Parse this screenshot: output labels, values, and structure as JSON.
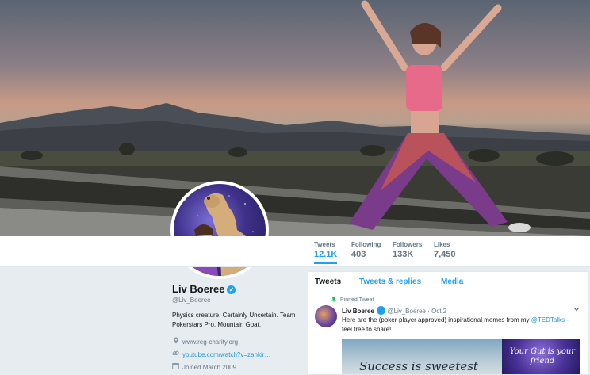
{
  "profile": {
    "name": "Liv Boeree",
    "verified_glyph": "✓",
    "handle": "@Liv_Boeree",
    "bio": "Physics creature. Certainly Uncertain. Team Pokerstars Pro. Mountain Goat.",
    "website": "www.reg-charity.org",
    "link": "youtube.com/watch?v=zankir…",
    "joined": "Joined March 2009"
  },
  "stats": [
    {
      "label": "Tweets",
      "value": "12.1K"
    },
    {
      "label": "Following",
      "value": "403"
    },
    {
      "label": "Followers",
      "value": "133K"
    },
    {
      "label": "Likes",
      "value": "7,450"
    }
  ],
  "timeline": {
    "tabs": [
      "Tweets",
      "Tweets & replies",
      "Media"
    ],
    "pinned_label": "Pinned Tweet",
    "tweet": {
      "name": "Liv Boeree",
      "handle": "@Liv_Boeree",
      "sep": "·",
      "date": "Oct 2",
      "text_before": "Here are the (poker-player approved) inspirational memes from my ",
      "mention": "@TEDTalks",
      "text_after": " - feel free to share!",
      "image_left_caption": "Success is sweetest",
      "image_right_caption": "Your Gut is your friend"
    }
  },
  "colors": {
    "accent": "#1da1f2",
    "link": "#1b95e0",
    "verified": "#1da1f2"
  },
  "icons": {
    "location": "location-pin-icon",
    "link": "link-icon",
    "calendar": "calendar-icon",
    "pin": "pin-icon",
    "chevron": "chevron-down-icon"
  }
}
